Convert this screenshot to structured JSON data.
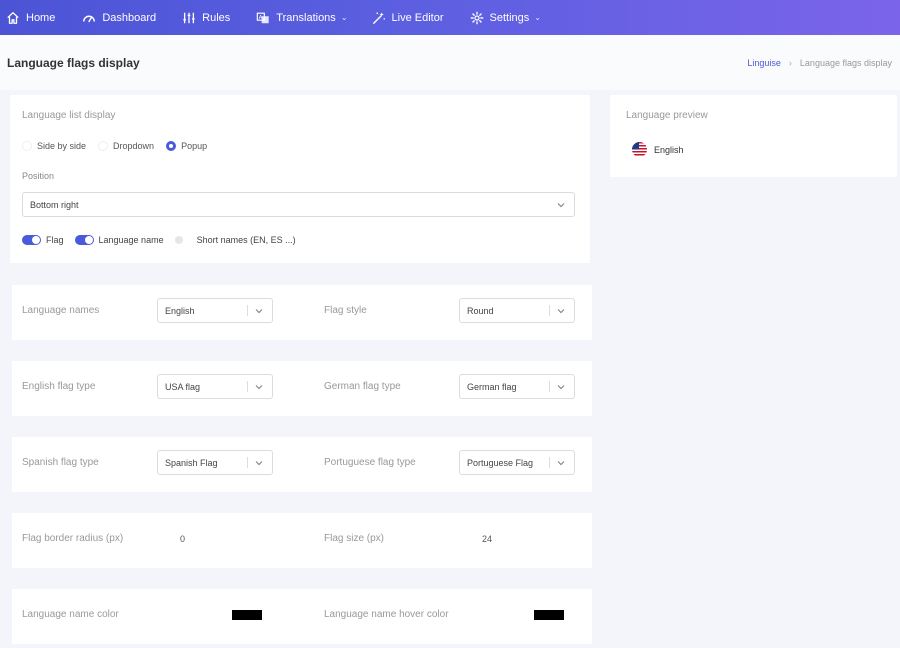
{
  "nav": {
    "home": "Home",
    "dashboard": "Dashboard",
    "rules": "Rules",
    "translations": "Translations",
    "live_editor": "Live Editor",
    "settings": "Settings"
  },
  "header": {
    "title": "Language flags display",
    "breadcrumb_root": "Linguise",
    "breadcrumb_current": "Language flags display"
  },
  "list_display": {
    "title": "Language list display",
    "options": [
      "Side by side",
      "Dropdown",
      "Popup"
    ],
    "selected": "Popup",
    "position_label": "Position",
    "position_value": "Bottom right",
    "toggles": {
      "flag": "Flag",
      "language_name": "Language name",
      "short_names": "Short names (EN, ES ...)"
    }
  },
  "preview": {
    "title": "Language preview",
    "language": "English"
  },
  "settings": {
    "language_names_label": "Language names",
    "language_names_value": "English",
    "flag_style_label": "Flag style",
    "flag_style_value": "Round",
    "english_flag_label": "English flag type",
    "english_flag_value": "USA flag",
    "german_flag_label": "German flag type",
    "german_flag_value": "German flag",
    "spanish_flag_label": "Spanish flag type",
    "spanish_flag_value": "Spanish Flag",
    "portuguese_flag_label": "Portuguese flag type",
    "portuguese_flag_value": "Portuguese Flag",
    "border_radius_label": "Flag border radius (px)",
    "border_radius_value": "0",
    "flag_size_label": "Flag size (px)",
    "flag_size_value": "24",
    "name_color_label": "Language name color",
    "name_color_value": "#000000",
    "hover_color_label": "Language name hover color",
    "hover_color_value": "#000000"
  },
  "colors": {
    "accent": "#4a5ad8",
    "nav_start": "#4c54d6",
    "nav_end": "#7b64ea"
  }
}
